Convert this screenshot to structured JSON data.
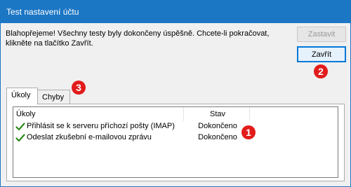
{
  "window": {
    "title": "Test nastavení účtu"
  },
  "message": "Blahopřejeme! Všechny testy byly dokončeny úspěšně. Chcete-li pokračovat, klikněte na tlačítko Zavřít.",
  "buttons": {
    "stop": "Zastavit",
    "close": "Zavřít"
  },
  "callouts": {
    "one": "1",
    "two": "2",
    "three": "3"
  },
  "tabs": [
    {
      "label": "Úkoly",
      "selected": true
    },
    {
      "label": "Chyby",
      "selected": false
    }
  ],
  "table": {
    "columns": [
      "Úkoly",
      "Stav"
    ],
    "rows": [
      {
        "task": "Přihlásit se k serveru příchozí pošty (IMAP)",
        "status": "Dokončeno",
        "icon": "check-icon"
      },
      {
        "task": "Odeslat zkušební e-mailovou zprávu",
        "status": "Dokončeno",
        "icon": "check-icon"
      }
    ]
  },
  "colors": {
    "titlebar": "#1b76c4",
    "callout": "#e21b1b",
    "check": "#2e8b1e"
  }
}
